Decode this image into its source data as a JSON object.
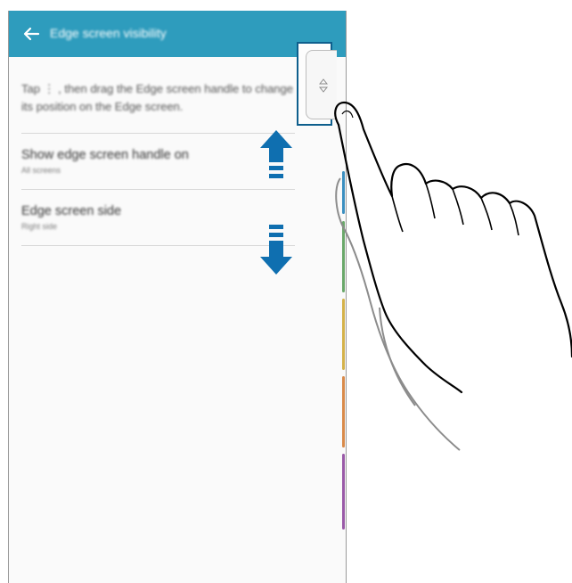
{
  "colors": {
    "app_bar": "#2e9cbd",
    "handle_frame": "#0e5f8d",
    "direction_arrow": "#0f6fb0",
    "edge_strips": [
      "#6aa86a",
      "#d4b24a",
      "#d98a4a",
      "#9a5aa8"
    ]
  },
  "app_bar": {
    "back_icon": "arrow-left-icon",
    "title": "Edge screen visibility"
  },
  "description": "Tap ⋮ , then drag the Edge screen handle to change its position on the Edge screen.",
  "settings": [
    {
      "title": "Show edge screen handle on",
      "value": "All screens"
    },
    {
      "title": "Edge screen side",
      "value": "Right side"
    }
  ],
  "edge_handle": {
    "icon": "up-down-arrows-icon"
  },
  "illustration": {
    "arrows": [
      "arrow-up-icon",
      "arrow-down-icon"
    ],
    "hand": "pointing-hand-icon"
  }
}
